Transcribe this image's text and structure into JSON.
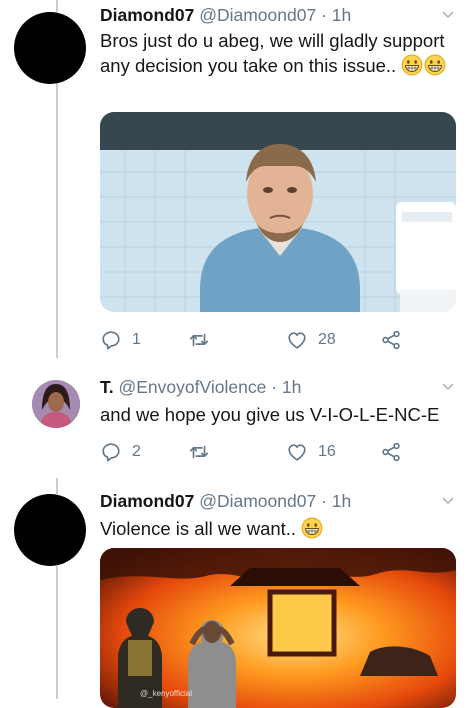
{
  "tweets": [
    {
      "name": "Diamond07",
      "handle": "@Diamoond07",
      "separator": "·",
      "time": "1h",
      "text": "Bros just do u abeg, we will gladly support any decision you take on this issue..",
      "emoji": [
        "grinning-emoji",
        "grinning-emoji"
      ],
      "media": "meme-image",
      "replies": "1",
      "retweets": "",
      "likes": "28"
    },
    {
      "name": "T.",
      "handle": "@EnvoyofViolence",
      "separator": "·",
      "time": "1h",
      "text": "and we hope you give us V-I-O-L-E-NC-E",
      "replies": "2",
      "retweets": "",
      "likes": "16"
    },
    {
      "name": "Diamond07",
      "handle": "@Diamoond07",
      "separator": "·",
      "time": "1h",
      "text": "Violence is all we want..",
      "emoji": [
        "grinning-emoji"
      ],
      "media": "burning-house-image",
      "media_watermark": "@_kenyofficial"
    }
  ],
  "icons": {
    "reply": "reply-icon",
    "retweet": "retweet-icon",
    "like": "heart-icon",
    "share": "share-icon",
    "more": "chevron-down-icon"
  },
  "colors": {
    "text_primary": "#14171a",
    "text_secondary": "#657786",
    "thread_line": "#c4cfd6",
    "background": "#ffffff"
  }
}
